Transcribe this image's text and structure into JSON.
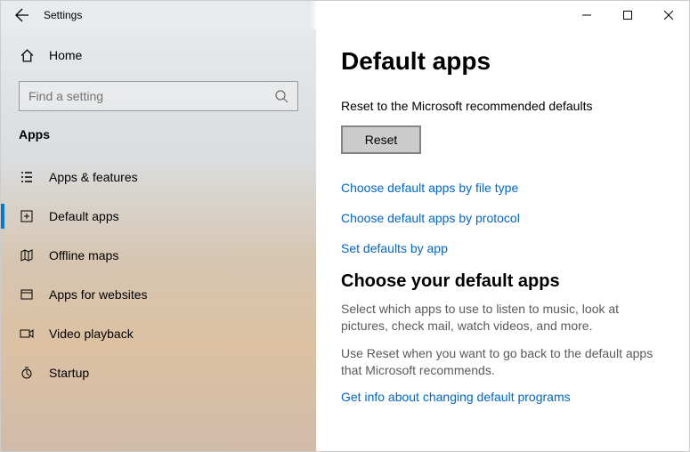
{
  "window": {
    "title": "Settings"
  },
  "sidebar": {
    "home": "Home",
    "search_placeholder": "Find a setting",
    "section": "Apps",
    "items": [
      {
        "label": "Apps & features"
      },
      {
        "label": "Default apps"
      },
      {
        "label": "Offline maps"
      },
      {
        "label": "Apps for websites"
      },
      {
        "label": "Video playback"
      },
      {
        "label": "Startup"
      }
    ]
  },
  "main": {
    "heading": "Default apps",
    "reset_caption": "Reset to the Microsoft recommended defaults",
    "reset_button": "Reset",
    "links": [
      "Choose default apps by file type",
      "Choose default apps by protocol",
      "Set defaults by app"
    ],
    "choose_heading": "Choose your default apps",
    "choose_desc1": "Select which apps to use to listen to music, look at pictures, check mail, watch videos, and more.",
    "choose_desc2": "Use Reset when you want to go back to the default apps that Microsoft recommends.",
    "info_link": "Get info about changing default programs"
  }
}
